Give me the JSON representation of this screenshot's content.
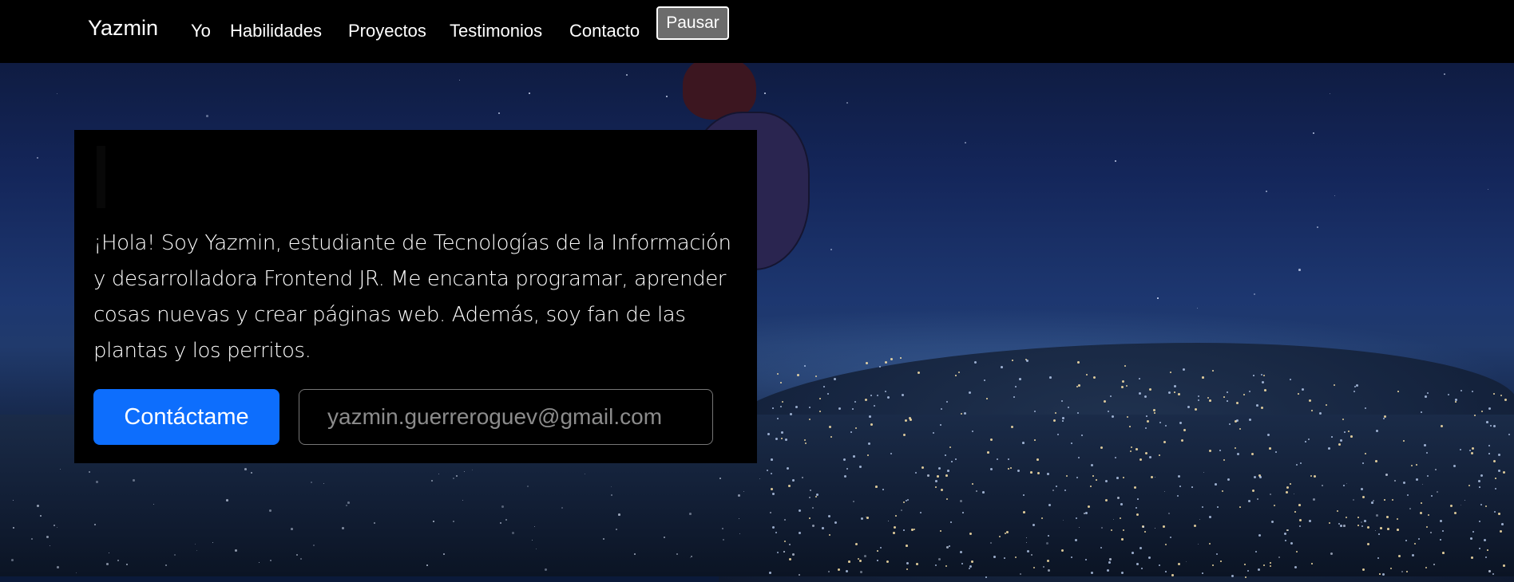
{
  "navbar": {
    "brand": "Yazmin",
    "links": [
      "Yo",
      "Habilidades",
      "Proyectos",
      "Testimonios",
      "Contacto"
    ],
    "pause_label": "Pausar"
  },
  "hero": {
    "intro": "¡Hola! Soy Yazmin, estudiante de Tecnologías de la Información y desarrolladora Frontend JR. Me encanta programar, aprender cosas nuevas y crear páginas web. Además, soy fan de las plantas y los perritos.",
    "contact_label": "Contáctame",
    "email_placeholder": "yazmin.guerreroguev@gmail.com"
  },
  "colors": {
    "navbar_bg": "#000000",
    "primary_button": "#0d6efd",
    "pause_button": "#6c6c6c"
  }
}
